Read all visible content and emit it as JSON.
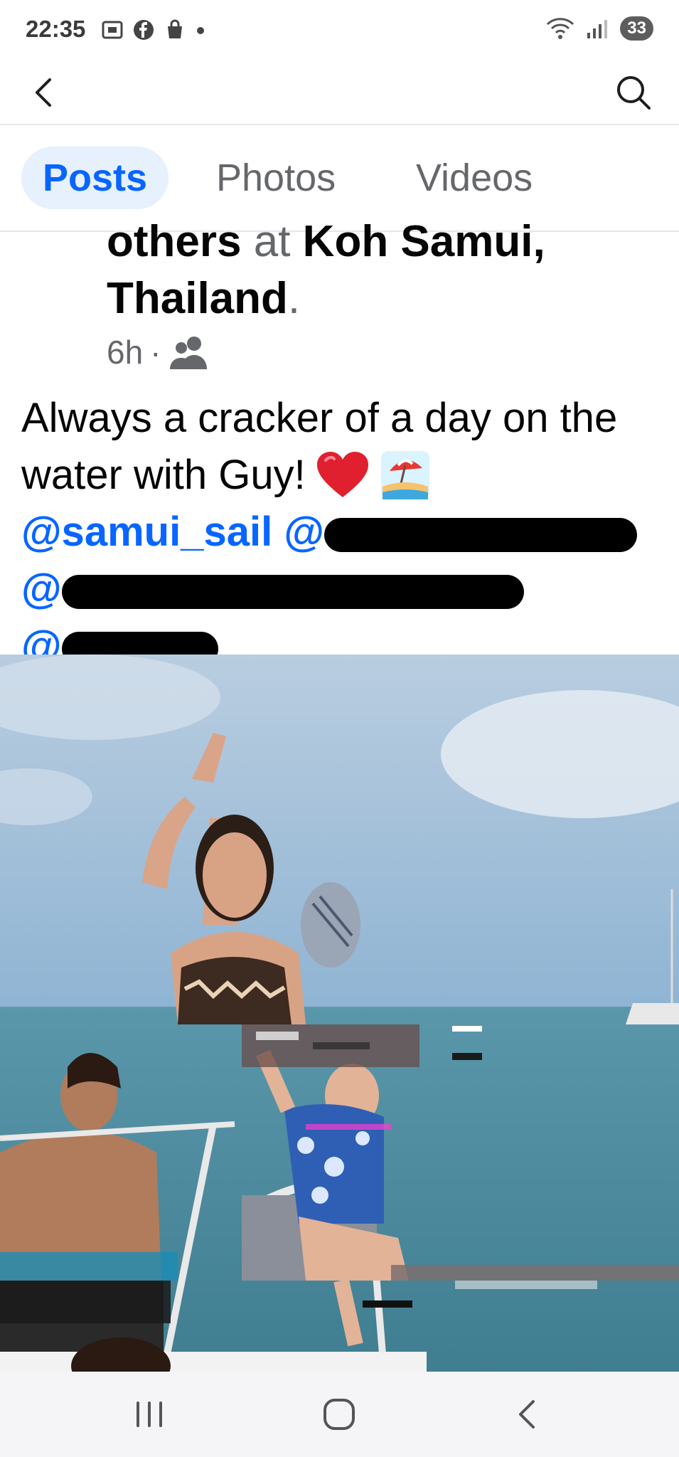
{
  "status_bar": {
    "time": "22:35",
    "battery": "33",
    "left_icons": [
      "screenshot-icon",
      "facebook-icon",
      "shopping-bag-icon",
      "dot-icon"
    ],
    "right_icons": [
      "wifi-icon",
      "signal-icon"
    ]
  },
  "top_nav": {
    "back_icon": "chevron-left-icon",
    "search_icon": "search-icon"
  },
  "tabs": [
    {
      "label": "Posts",
      "active": true
    },
    {
      "label": "Photos",
      "active": false
    },
    {
      "label": "Videos",
      "active": false
    }
  ],
  "post": {
    "header_others": "others",
    "header_at": "at",
    "header_place_line1": "Koh Samui,",
    "header_place_line2": "Thailand",
    "header_period": ".",
    "time_ago": "6h",
    "meta_separator": "·",
    "audience_icon": "friends-icon",
    "body_line1": "Always a cracker of a day on the",
    "body_line2": "water with Guy!",
    "emojis": [
      "heart-icon",
      "beach-umbrella-icon"
    ],
    "mention_1": "@samui_sail",
    "mention_2_prefix": "@",
    "mention_3_prefix": "@",
    "mention_4_prefix": "@"
  },
  "photo": {
    "description_icon": "photo"
  },
  "bottom_nav": {
    "recents_icon": "recents-icon",
    "home_icon": "home-icon",
    "back_icon": "back-icon"
  }
}
